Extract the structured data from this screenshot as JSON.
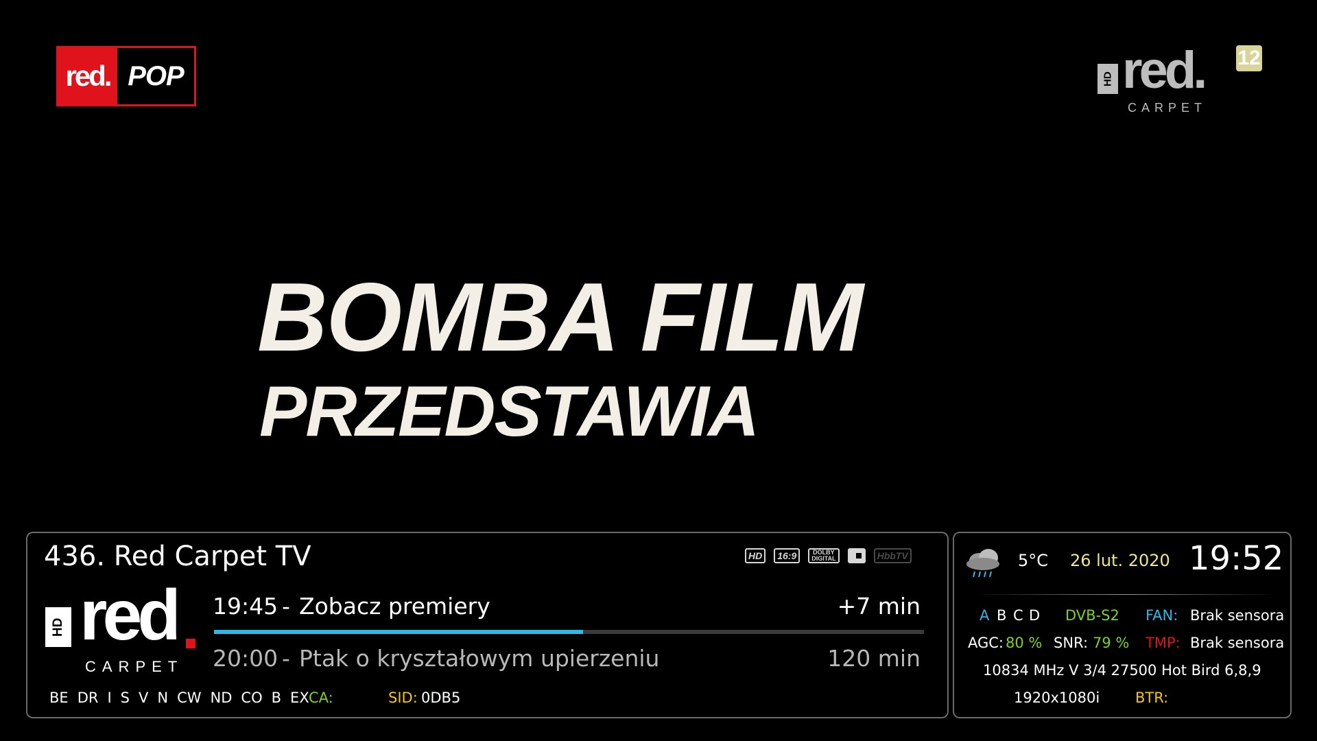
{
  "logos": {
    "top_left": {
      "left_text": "red.",
      "right_text": "POP"
    },
    "top_right": {
      "hd": "HD",
      "word": "red.",
      "sub": "CARPET"
    },
    "age_rating": "12"
  },
  "video": {
    "title_line1": "BOMBA FILM",
    "title_line2": "PRZEDSTAWIA"
  },
  "infobar": {
    "channel_title": "436. Red Carpet TV",
    "feature_icons": [
      "HD",
      "16:9",
      "DOLBY DIGITAL",
      "subtitles-icon",
      "HbbTV"
    ],
    "feature_icon_labels": {
      "hd": "HD",
      "aspect": "16:9",
      "dolby_top": "DOLBY",
      "dolby_bottom": "DIGITAL",
      "hbbtv": "HbbTV"
    },
    "channel_logo": {
      "hd": "HD",
      "word": "red",
      "sub": "CARPET"
    },
    "now": {
      "time": "19:45",
      "separator": "-",
      "title": "Zobacz premiery",
      "remaining": "+7 min"
    },
    "next": {
      "time": "20:00",
      "separator": "-",
      "title": "Ptak o kryształowym upierzeniu",
      "duration": "120 min"
    },
    "progress_percent": 52,
    "cas_systems": [
      "BE",
      "DR",
      "I",
      "S",
      "V",
      "N",
      "CW",
      "ND",
      "CO",
      "B",
      "EX"
    ],
    "ca_label": "CA:",
    "sid_label": "SID:",
    "sid_value": "0DB5"
  },
  "status_panel": {
    "weather_icon": "rain-cloud-icon",
    "temperature": "5°C",
    "date": "26 lut. 2020",
    "clock": "19:52",
    "tuners": [
      "A",
      "B",
      "C",
      "D"
    ],
    "system": "DVB-S2",
    "fan_label": "FAN:",
    "fan_value": "Brak sensora",
    "agc_label": "AGC:",
    "agc_value": "80 %",
    "snr_label": "SNR:",
    "snr_value": "79 %",
    "tmp_label": "TMP:",
    "tmp_value": "Brak sensora",
    "transponder": "10834 MHz  V  3/4  27500  Hot Bird 6,8,9",
    "resolution": "1920x1080i",
    "btr_label": "BTR:"
  },
  "colors": {
    "accent_blue": "#2fb7e6",
    "green": "#7ed321",
    "yellow": "#f5c518",
    "red": "#e0121b",
    "date_yellow": "#f0e68c"
  }
}
